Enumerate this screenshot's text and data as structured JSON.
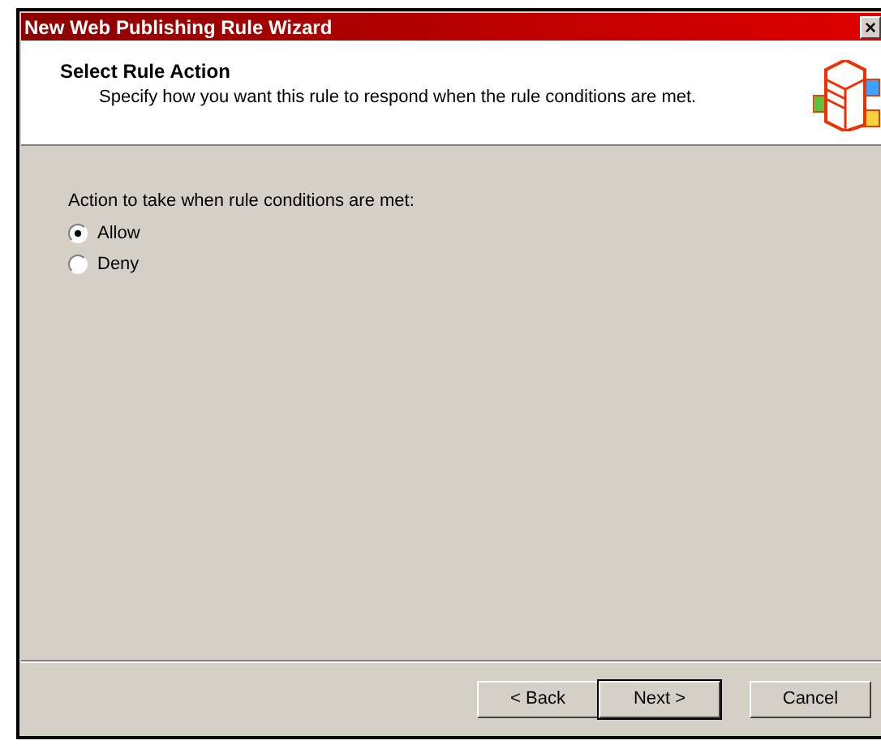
{
  "window": {
    "title": "New Web Publishing Rule Wizard",
    "close": "×"
  },
  "header": {
    "title": "Select Rule Action",
    "subtitle": "Specify how you want this rule to respond when the rule conditions are met."
  },
  "prompt": "Action to take when rule conditions are met:",
  "options": [
    {
      "label": "Allow",
      "selected": true
    },
    {
      "label": "Deny",
      "selected": false
    }
  ],
  "buttons": [
    {
      "label": "< Back",
      "default": false
    },
    {
      "label": "Next >",
      "default": true
    },
    {
      "label": "Cancel",
      "default": false
    }
  ]
}
